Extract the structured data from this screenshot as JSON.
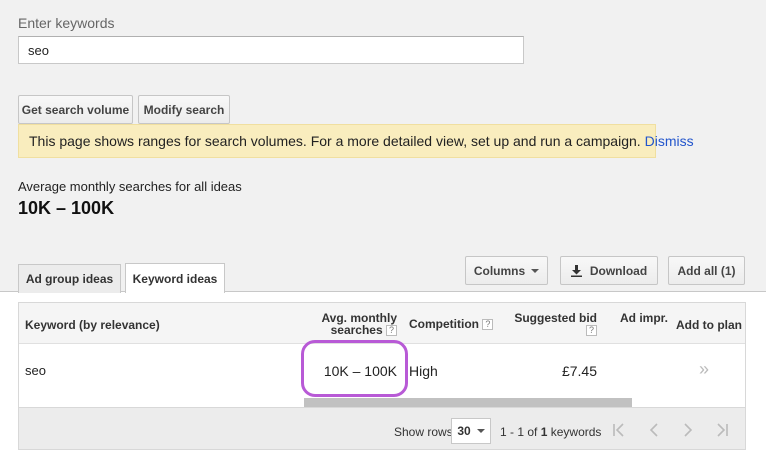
{
  "search": {
    "label": "Enter keywords",
    "value": "seo"
  },
  "buttons": {
    "get_volume": "Get search volume",
    "modify": "Modify search",
    "columns": "Columns",
    "download": "Download",
    "add_all": "Add all (1)"
  },
  "notice": {
    "text": "This page shows ranges for search volumes. For a more detailed view, set up and run a campaign.",
    "dismiss": "Dismiss"
  },
  "summary": {
    "label": "Average monthly searches for all ideas",
    "value": "10K – 100K"
  },
  "tabs": [
    {
      "label": "Ad group ideas",
      "active": false
    },
    {
      "label": "Keyword ideas",
      "active": true
    }
  ],
  "table": {
    "headers": {
      "keyword": "Keyword (by relevance)",
      "avg_line1": "Avg. monthly",
      "avg_line2": "searches",
      "competition": "Competition",
      "bid": "Suggested bid",
      "impr": "Ad impr.",
      "add": "Add to plan"
    },
    "help_icon": "?",
    "rows": [
      {
        "keyword": "seo",
        "avg": "10K – 100K",
        "competition": "High",
        "bid": "£7.45",
        "impr": "",
        "add": "»"
      }
    ]
  },
  "footer": {
    "show_rows_label": "Show rows",
    "rows_value": "30",
    "range_prefix": "1 - 1 of",
    "range_count": "1",
    "range_suffix": "keywords"
  },
  "colors": {
    "notice_bg": "#f9edbe",
    "link": "#2255cc",
    "highlight": "#b85ad6"
  }
}
